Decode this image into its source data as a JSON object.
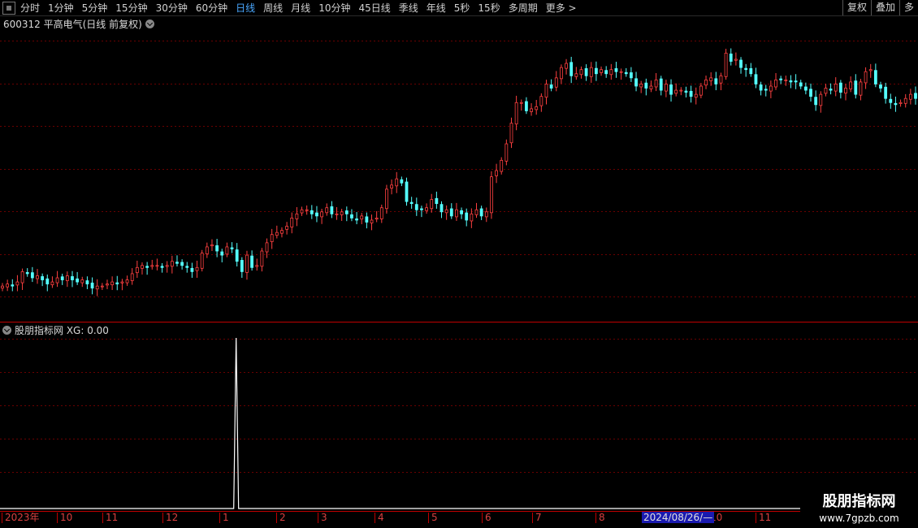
{
  "toolbar": {
    "periods": [
      "分时",
      "1分钟",
      "5分钟",
      "15分钟",
      "30分钟",
      "60分钟",
      "日线",
      "周线",
      "月线",
      "10分钟",
      "45日线",
      "季线",
      "年线",
      "5秒",
      "15秒",
      "多周期",
      "更多 >"
    ],
    "active_period": "日线",
    "right_buttons": [
      "复权",
      "叠加",
      "多"
    ]
  },
  "stock": {
    "title": "600312 平高电气(日线 前复权)"
  },
  "indicator": {
    "title": "股朋指标网 XG: 0.00"
  },
  "colors": {
    "up": "#ff4040",
    "down": "#54ffff",
    "grid": "#6a0000",
    "divider": "#c00000",
    "axis_text": "#d84040"
  },
  "x_axis": {
    "labels": [
      "2023年",
      "10",
      "11",
      "12",
      "1",
      "2",
      "3",
      "4",
      "5",
      "6",
      "7",
      "8",
      "10",
      "11"
    ],
    "highlight": "2024/08/26/—"
  },
  "watermark": {
    "line1": "股朋指标网",
    "line2": "www.7gpzb.com"
  },
  "chart_data": [
    {
      "type": "candlestick",
      "title": "600312 平高电气(日线 前复权)",
      "note": "price series approximated; price scale not shown",
      "close": [
        11.9,
        12.0,
        11.9,
        12.1,
        12.6,
        12.5,
        12.3,
        12.4,
        12.2,
        12.0,
        12.1,
        12.3,
        12.2,
        12.4,
        12.2,
        12.1,
        12.2,
        12.0,
        11.8,
        11.9,
        11.9,
        12.0,
        12.1,
        12.0,
        12.1,
        12.2,
        12.5,
        12.8,
        12.9,
        12.8,
        12.9,
        12.9,
        12.8,
        12.9,
        13.1,
        13.0,
        12.9,
        12.8,
        12.6,
        12.8,
        13.5,
        13.8,
        13.9,
        13.6,
        13.4,
        13.8,
        13.7,
        13.1,
        12.6,
        13.4,
        12.8,
        12.9,
        13.6,
        14.0,
        14.4,
        14.5,
        14.6,
        14.8,
        15.2,
        15.4,
        15.6,
        15.6,
        15.4,
        15.3,
        15.5,
        15.7,
        15.4,
        15.4,
        15.5,
        15.4,
        15.2,
        15.1,
        15.3,
        15.0,
        15.1,
        15.2,
        15.7,
        16.6,
        16.8,
        17.1,
        16.9,
        16.0,
        15.9,
        15.6,
        15.6,
        15.7,
        16.1,
        15.9,
        15.5,
        15.6,
        15.3,
        15.6,
        15.4,
        15.1,
        15.4,
        15.6,
        15.3,
        15.5,
        17.2,
        17.5,
        18.0,
        18.8,
        19.8,
        20.8,
        20.8,
        20.4,
        20.5,
        20.6,
        21.1,
        21.7,
        21.5,
        22.0,
        22.5,
        22.7,
        22.1,
        22.2,
        22.4,
        22.1,
        22.5,
        22.2,
        22.4,
        22.2,
        22.4,
        22.3,
        22.3,
        22.2,
        22.0,
        21.6,
        21.7,
        21.5,
        21.6,
        21.9,
        21.4,
        21.7,
        21.2,
        21.4,
        21.4,
        21.3,
        21.1,
        21.2,
        21.6,
        21.9,
        22.0,
        21.7,
        22.1,
        23.2,
        22.8,
        22.9,
        22.5,
        22.4,
        22.2,
        21.7,
        21.4,
        21.4,
        21.6,
        21.9,
        21.9,
        21.9,
        21.8,
        21.8,
        21.6,
        21.4,
        21.1,
        20.7,
        21.2,
        21.5,
        21.4,
        21.7,
        21.3,
        21.5,
        21.8,
        21.2,
        21.8,
        22.3,
        22.4,
        21.7,
        21.5,
        21.0,
        20.8,
        20.7,
        20.8,
        21.0,
        21.2,
        21.0
      ]
    },
    {
      "type": "line",
      "title": "股朋指标网 XG",
      "series": [
        {
          "name": "XG",
          "spikes": [
            {
              "index": 47,
              "value": 1
            }
          ]
        }
      ],
      "last_value": 0.0
    }
  ]
}
